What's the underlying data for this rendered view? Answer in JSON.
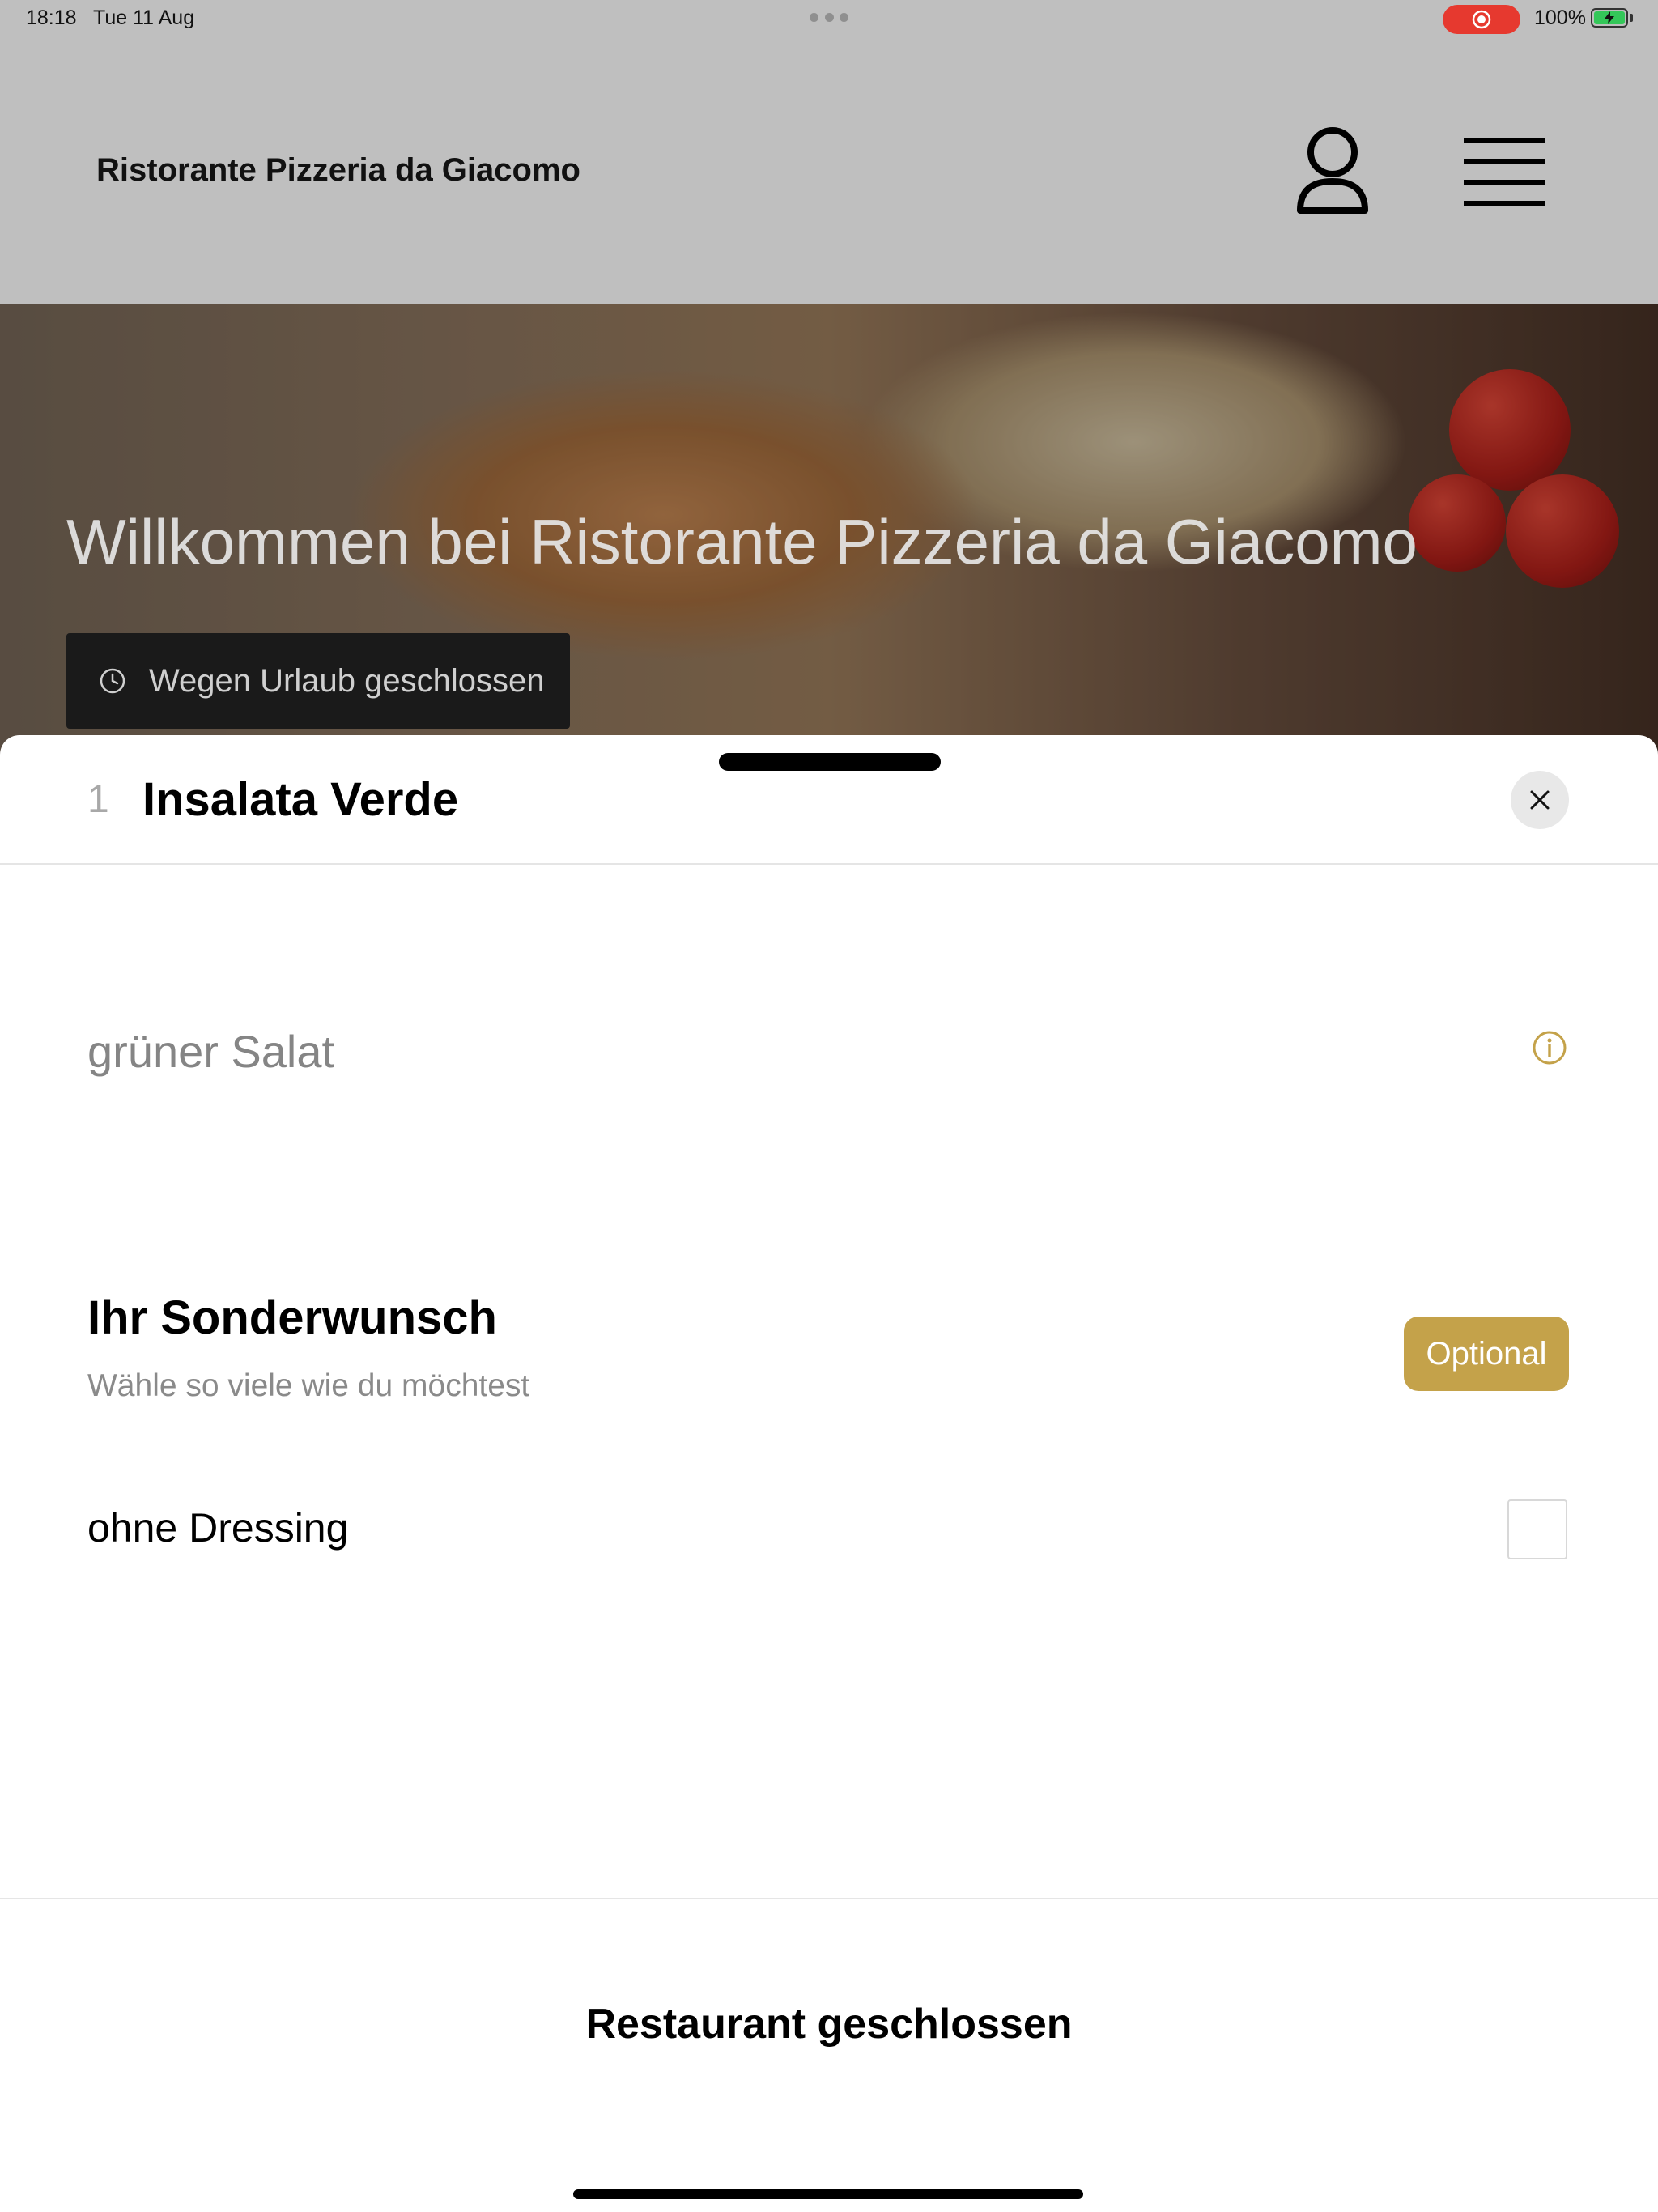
{
  "status_bar": {
    "time": "18:18",
    "date": "Tue 11 Aug",
    "battery": "100%",
    "recording_color": "#e6392f",
    "battery_color": "#34c759"
  },
  "header": {
    "title": "Ristorante Pizzeria da Giacomo",
    "account_icon": "person-icon",
    "menu_icon": "hamburger-menu-icon"
  },
  "hero": {
    "title": "Willkommen bei Ristorante Pizzeria da Giacomo",
    "closed_notice": "Wegen Urlaub geschlossen",
    "closed_icon": "clock-icon"
  },
  "sheet": {
    "quantity": "1",
    "title": "Insalata Verde",
    "close_icon": "close-icon",
    "description": "grüner Salat",
    "info_icon": "info-icon",
    "options_group": {
      "title": "Ihr Sonderwunsch",
      "subtitle": "Wähle so viele wie du möchtest",
      "badge": "Optional",
      "badge_color": "#c4a24a",
      "options": [
        {
          "label": "ohne Dressing",
          "checked": false
        }
      ]
    },
    "footer_status": "Restaurant geschlossen"
  }
}
